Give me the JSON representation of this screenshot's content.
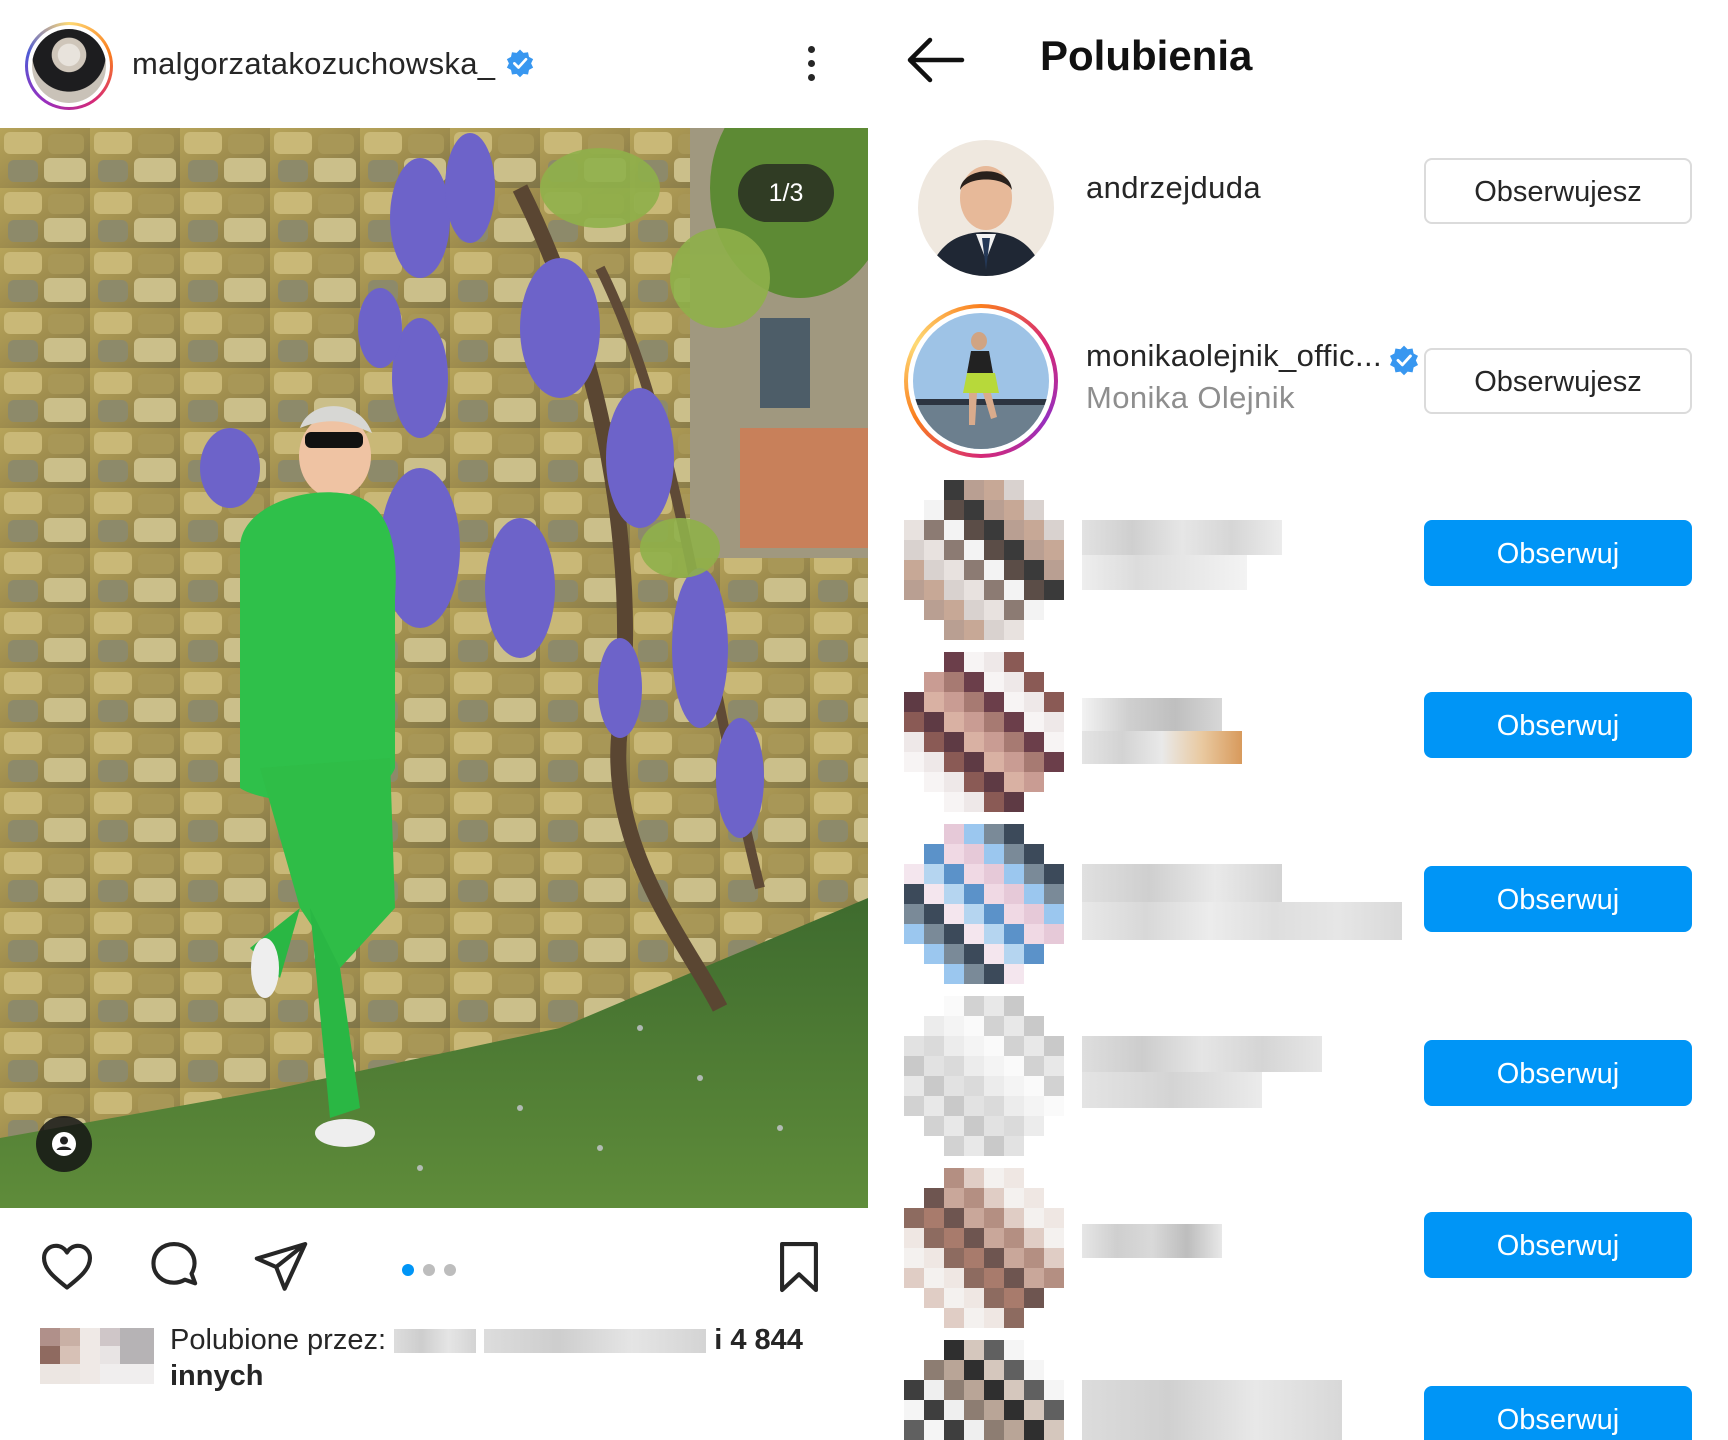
{
  "post": {
    "username": "malgorzatakozuchowska_",
    "icons": {
      "verified": "verified-badge-icon",
      "more": "more-vertical-icon",
      "like": "heart-icon",
      "comment": "comment-icon",
      "share": "send-icon",
      "save": "bookmark-icon",
      "tags": "user-tag-icon"
    },
    "image_counter": "1/3",
    "carousel": {
      "total": 3,
      "active": 1
    },
    "likes_prefix": "Polubione przez:",
    "likes_count_text": "i 4 844",
    "likes_suffix": "innych"
  },
  "likes_screen": {
    "title": "Polubienia",
    "back_icon": "arrow-left-icon",
    "users": [
      {
        "username": "andrzejduda",
        "full_name": "",
        "verified": false,
        "button": "Obserwujesz",
        "following": true
      },
      {
        "username": "monikaolejnik_offic...",
        "full_name": "Monika Olejnik",
        "verified": true,
        "button": "Obserwujesz",
        "following": true
      },
      {
        "username": "",
        "full_name": "",
        "verified": false,
        "button": "Obserwuj",
        "following": false
      },
      {
        "username": "",
        "full_name": "",
        "verified": false,
        "button": "Obserwuj",
        "following": false
      },
      {
        "username": "",
        "full_name": "",
        "verified": false,
        "button": "Obserwuj",
        "following": false
      },
      {
        "username": "",
        "full_name": "",
        "verified": false,
        "button": "Obserwuj",
        "following": false
      },
      {
        "username": "",
        "full_name": "",
        "verified": false,
        "button": "Obserwuj",
        "following": false
      },
      {
        "username": "",
        "full_name": "",
        "verified": false,
        "button": "Obserwuj",
        "following": false
      }
    ]
  },
  "colors": {
    "accent_blue": "#0095f6",
    "text_primary": "#262626",
    "text_secondary": "#8e8e8e",
    "border": "#dbdbdb"
  }
}
